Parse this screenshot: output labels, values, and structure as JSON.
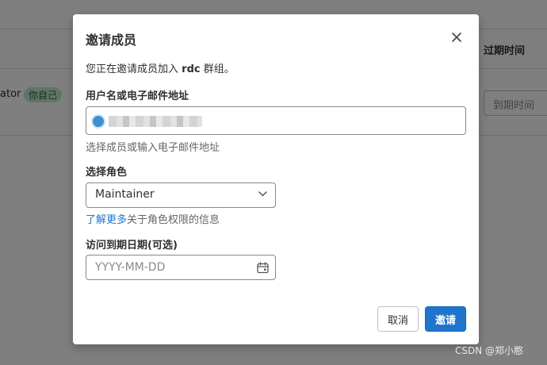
{
  "background": {
    "table_header_expire": "过期时间",
    "member_name_fragment": "ator",
    "self_badge": "你自己",
    "expire_placeholder": "到期时间"
  },
  "modal": {
    "title": "邀请成员",
    "intro_prefix": "您正在邀请成员加入",
    "group_name": "rdc",
    "intro_suffix": "群组。",
    "user_field": {
      "label": "用户名或电子邮件地址",
      "help": "选择成员或输入电子邮件地址"
    },
    "role_field": {
      "label": "选择角色",
      "selected": "Maintainer",
      "learn_more": "了解更多",
      "help_suffix": "关于角色权限的信息"
    },
    "date_field": {
      "label": "访问到期日期(可选)",
      "placeholder": "YYYY-MM-DD"
    },
    "cancel_label": "取消",
    "invite_label": "邀请"
  },
  "watermark": "CSDN @郑小憨",
  "colors": {
    "primary": "#1f75cb",
    "overlay": "rgba(0,0,0,0.5)",
    "badge_bg": "#c3e6cd",
    "badge_text": "#24663b"
  },
  "icons": {
    "close": "close-icon",
    "dropdown": "chevron-down-icon",
    "calendar": "calendar-icon"
  }
}
